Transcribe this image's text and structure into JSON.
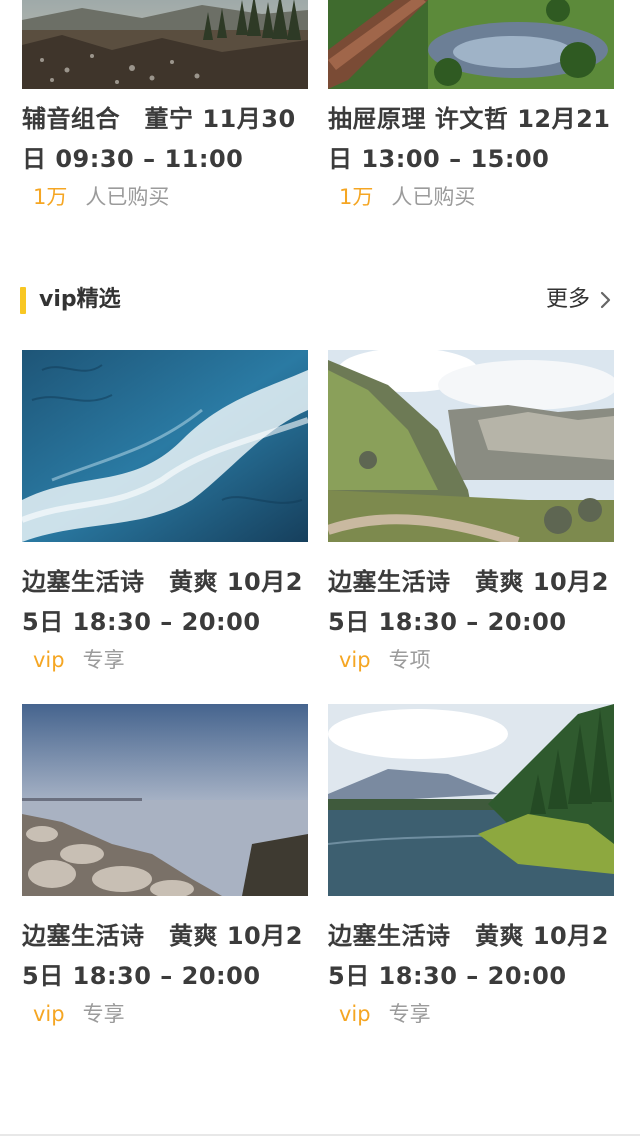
{
  "top_cards": [
    {
      "title": "辅音组合　董宁 11月30日 09:30 – 11:00",
      "count": "1万",
      "count_suffix": "人已购买",
      "image_icon": "landscape-image"
    },
    {
      "title": "抽屉原理 许文哲 12月21日 13:00 – 15:00",
      "count": "1万",
      "count_suffix": "人已购买",
      "image_icon": "landscape-image"
    }
  ],
  "vip_section": {
    "title": "vip精选",
    "more_label": "更多",
    "more_icon": "chevron-right-icon",
    "accent_color": "#f8c723"
  },
  "vip_cards": [
    {
      "title": "边塞生活诗　黄爽 10月25日 18:30 – 20:00",
      "tag": "vip",
      "tag_suffix": "专享"
    },
    {
      "title": "边塞生活诗　黄爽 10月25日 18:30 – 20:00",
      "tag": "vip",
      "tag_suffix": "专项"
    },
    {
      "title": "边塞生活诗　黄爽 10月25日 18:30 – 20:00",
      "tag": "vip",
      "tag_suffix": "专享"
    },
    {
      "title": "边塞生活诗　黄爽 10月25日 18:30 – 20:00",
      "tag": "vip",
      "tag_suffix": "专享"
    }
  ],
  "colors": {
    "accent": "#f5a623",
    "title_text": "#3b3b3b",
    "muted_text": "#9b9b9b"
  }
}
